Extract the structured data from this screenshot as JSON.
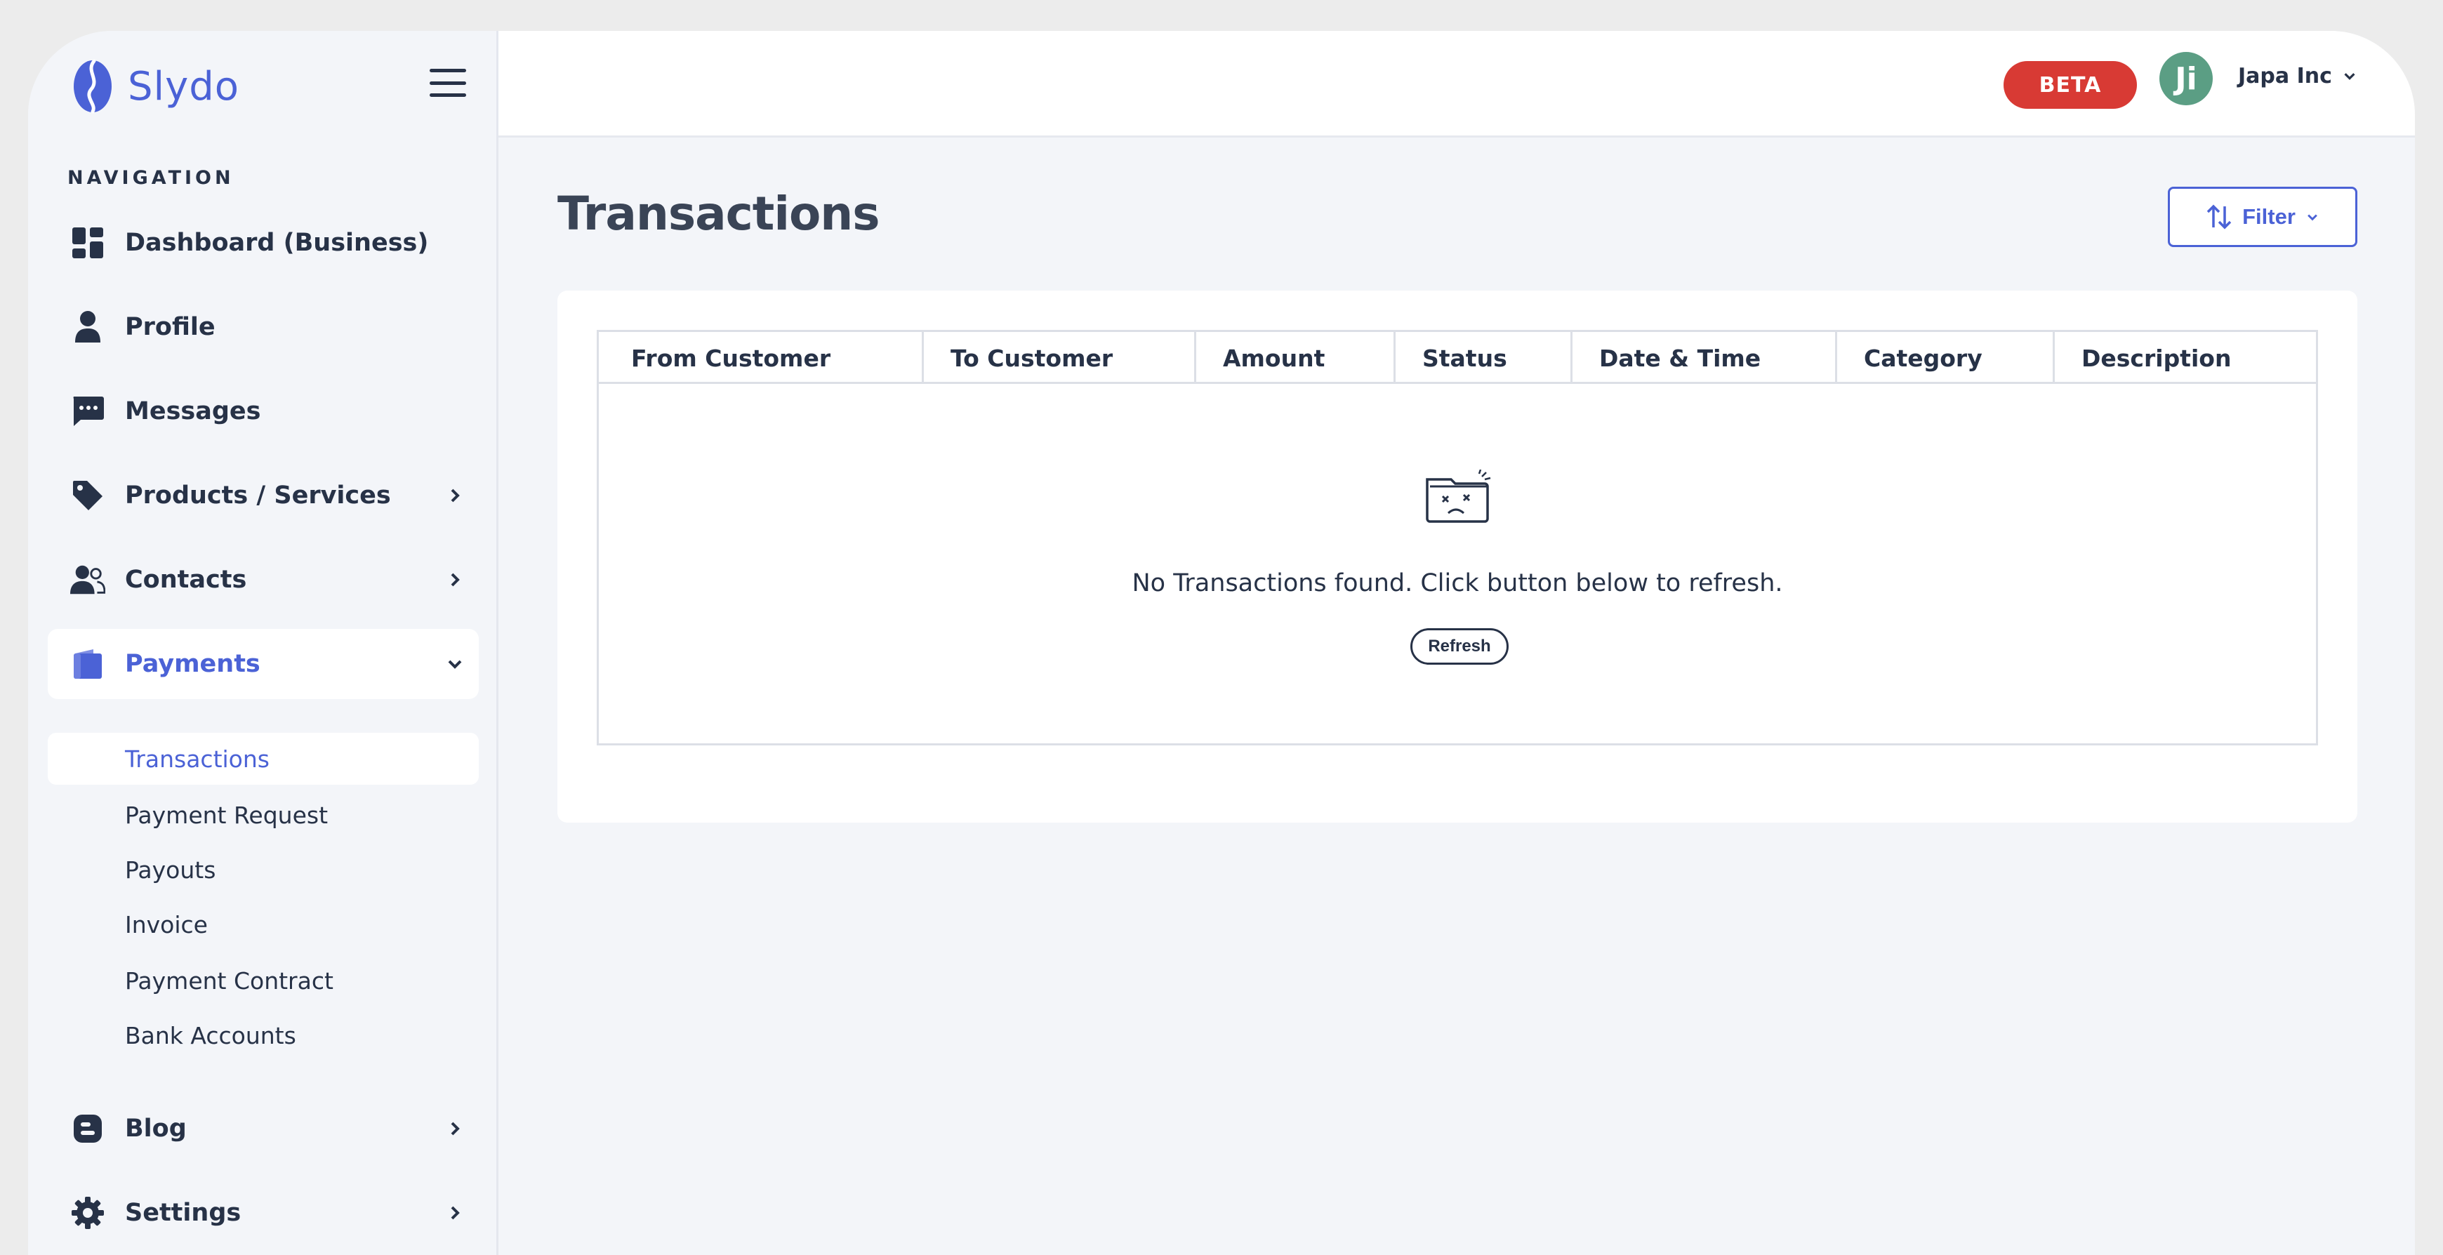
{
  "brand": {
    "name": "Slydo",
    "logo_icon": "coffee-bean-logo",
    "accent": "#4b62d6"
  },
  "sidebar": {
    "heading": "NAVIGATION",
    "items": [
      {
        "label": "Dashboard (Business)",
        "icon": "dashboard-grid-icon"
      },
      {
        "label": "Profile",
        "icon": "user-icon"
      },
      {
        "label": "Messages",
        "icon": "chat-icon"
      },
      {
        "label": "Products / Services",
        "icon": "tag-icon",
        "has_children": true
      },
      {
        "label": "Contacts",
        "icon": "users-icon",
        "has_children": true
      },
      {
        "label": "Payments",
        "icon": "wallet-icon",
        "expanded": true,
        "active": true
      },
      {
        "label": "Blog",
        "icon": "blogger-icon",
        "has_children": true
      },
      {
        "label": "Settings",
        "icon": "gear-icon",
        "has_children": true
      }
    ],
    "payments_subitems": [
      {
        "label": "Transactions",
        "active": true
      },
      {
        "label": "Payment Request"
      },
      {
        "label": "Payouts"
      },
      {
        "label": "Invoice"
      },
      {
        "label": "Payment Contract"
      },
      {
        "label": "Bank Accounts"
      }
    ]
  },
  "topbar": {
    "badge": "BETA",
    "badge_color": "#d83a34",
    "avatar_initials": "Ji",
    "avatar_color": "#5b9e84",
    "account_name": "Japa Inc"
  },
  "main": {
    "title": "Transactions",
    "filter_label": "Filter",
    "table": {
      "columns": [
        "From Customer",
        "To Customer",
        "Amount",
        "Status",
        "Date & Time",
        "Category",
        "Description"
      ],
      "rows": [],
      "empty_message": "No Transactions found. Click button below to refresh.",
      "refresh_label": "Refresh"
    }
  }
}
